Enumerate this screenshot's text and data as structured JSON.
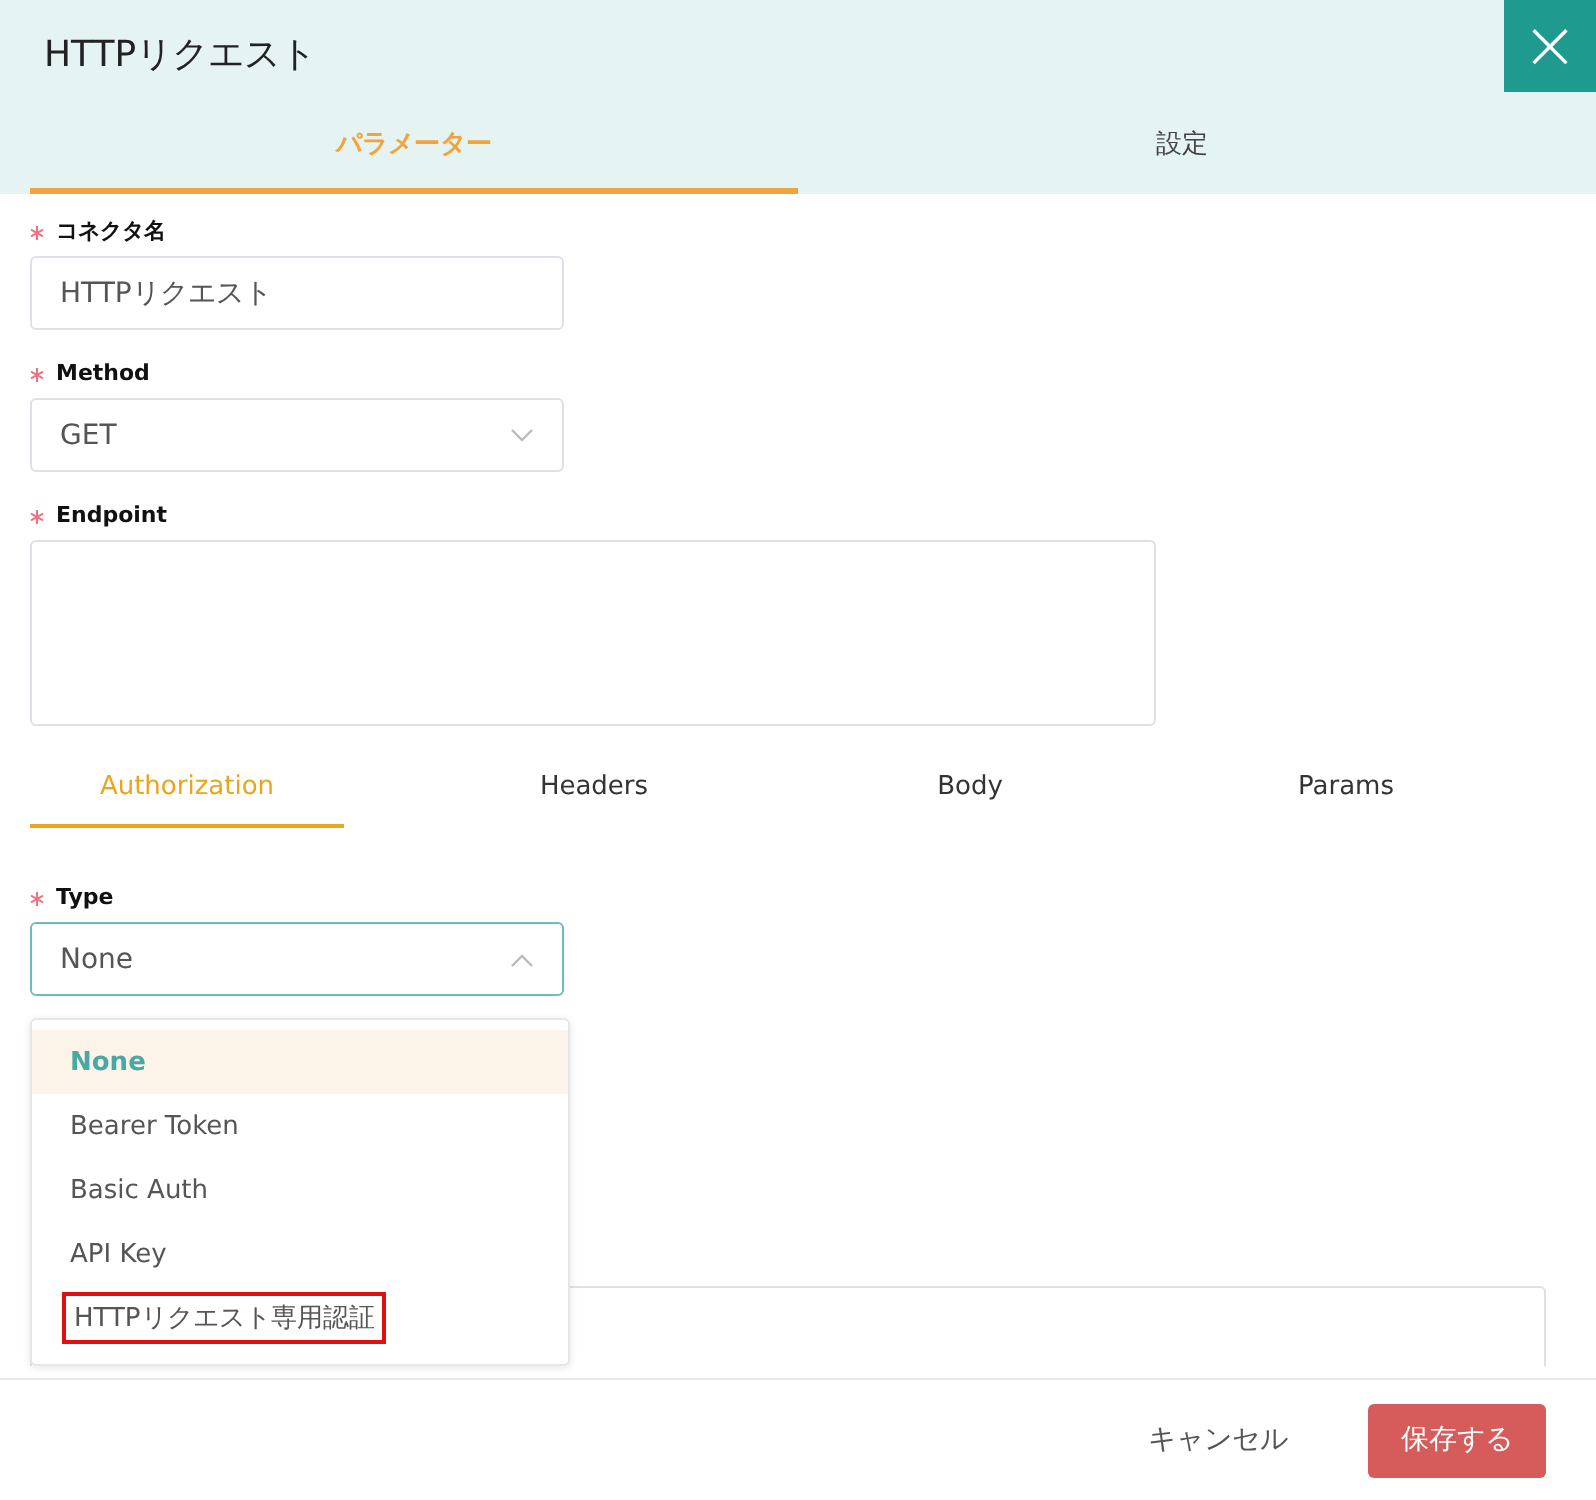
{
  "dialog": {
    "title": "HTTPリクエスト",
    "close": "×"
  },
  "tabs": [
    {
      "label": "パラメーター",
      "selected": true
    },
    {
      "label": "設定",
      "selected": false
    }
  ],
  "fields": [
    {
      "kind": "text",
      "label": "コネクタ名",
      "required": true,
      "value": "HTTPリクエスト"
    },
    {
      "kind": "select",
      "label": "Method",
      "required": true,
      "value": "GET"
    },
    {
      "kind": "textarea",
      "label": "Endpoint",
      "required": true
    }
  ],
  "subtabs": [
    {
      "label": "Authorization",
      "selected": true
    },
    {
      "label": "Headers",
      "selected": false
    },
    {
      "label": "Body",
      "selected": false
    },
    {
      "label": "Params",
      "selected": false
    }
  ],
  "type_field": {
    "label": "Type",
    "required": true,
    "value": "None",
    "expanded": true
  },
  "dropdown": [
    {
      "label": "None",
      "selected": true,
      "highlighted": false
    },
    {
      "label": "Bearer Token",
      "selected": false,
      "highlighted": false
    },
    {
      "label": "Basic Auth",
      "selected": false,
      "highlighted": false
    },
    {
      "label": "API Key",
      "selected": false,
      "highlighted": false
    },
    {
      "label": "HTTPリクエスト専用認証",
      "selected": false,
      "highlighted": true
    }
  ],
  "footer": {
    "cancel": "キャンセル",
    "save": "保存する"
  }
}
